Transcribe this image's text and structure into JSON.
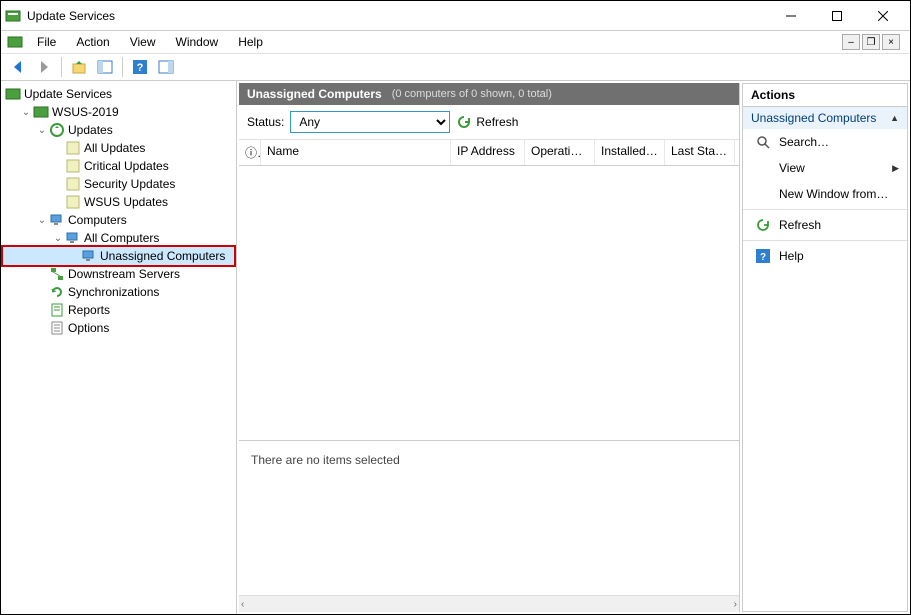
{
  "window": {
    "title": "Update Services"
  },
  "menu": {
    "file": "File",
    "action": "Action",
    "view": "View",
    "window": "Window",
    "help": "Help"
  },
  "tree": {
    "root": "Update Services",
    "server": "WSUS-2019",
    "updates": "Updates",
    "all_updates": "All Updates",
    "critical_updates": "Critical Updates",
    "security_updates": "Security Updates",
    "wsus_updates": "WSUS Updates",
    "computers": "Computers",
    "all_computers": "All Computers",
    "unassigned_computers": "Unassigned Computers",
    "downstream_servers": "Downstream Servers",
    "synchronizations": "Synchronizations",
    "reports": "Reports",
    "options": "Options"
  },
  "content": {
    "header_title": "Unassigned Computers",
    "header_sub": "(0 computers of 0 shown, 0 total)",
    "status_label": "Status:",
    "status_value": "Any",
    "refresh": "Refresh",
    "columns": {
      "info": "ⓘ",
      "name": "Name",
      "ip": "IP Address",
      "os": "Operatin…",
      "installed": "Installed…",
      "last": "Last Stat…"
    },
    "detail_empty": "There are no items selected"
  },
  "actions": {
    "title": "Actions",
    "group": "Unassigned Computers",
    "search": "Search…",
    "view": "View",
    "new_window": "New Window from…",
    "refresh": "Refresh",
    "help": "Help"
  }
}
